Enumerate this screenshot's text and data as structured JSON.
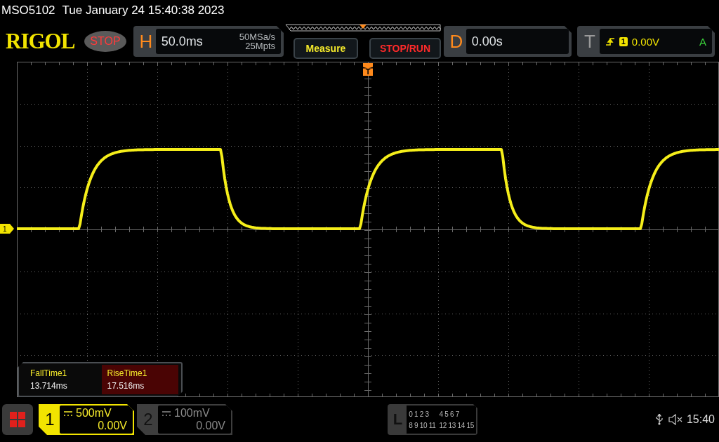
{
  "status_line": {
    "model": "MSO5102",
    "datetime": "Tue January 24 15:40:38 2023"
  },
  "header": {
    "logo": "RIGOL",
    "run_state": "STOP",
    "horizontal": {
      "label": "H",
      "timebase": "50.0ms",
      "sample_rate": "50MSa/s",
      "memory_depth": "25Mpts"
    },
    "buttons": [
      {
        "label": "Measure",
        "kind": "measure"
      },
      {
        "label": "STOP/RUN",
        "kind": "run"
      }
    ],
    "delay": {
      "label": "D",
      "value": "0.00s"
    },
    "trigger": {
      "label": "T",
      "source": "1",
      "level": "0.00V",
      "mode": "A"
    }
  },
  "trigger_marker": "T",
  "channel_marker": "1",
  "measurements": [
    {
      "name": "FallTime1",
      "value": "13.714ms",
      "selected": false
    },
    {
      "name": "RiseTime1",
      "value": "17.516ms",
      "selected": true
    }
  ],
  "channels": [
    {
      "number": "1",
      "scale": "500mV",
      "offset": "0.00V",
      "on": true
    },
    {
      "number": "2",
      "scale": "100mV",
      "offset": "0.00V",
      "on": false
    }
  ],
  "logic": {
    "label": "L",
    "row_1": [
      "0 1 2 3",
      "4 5 6 7"
    ],
    "row_2": [
      "8 9 10 11",
      "12 13 14 15"
    ]
  },
  "clock": "15:40"
}
